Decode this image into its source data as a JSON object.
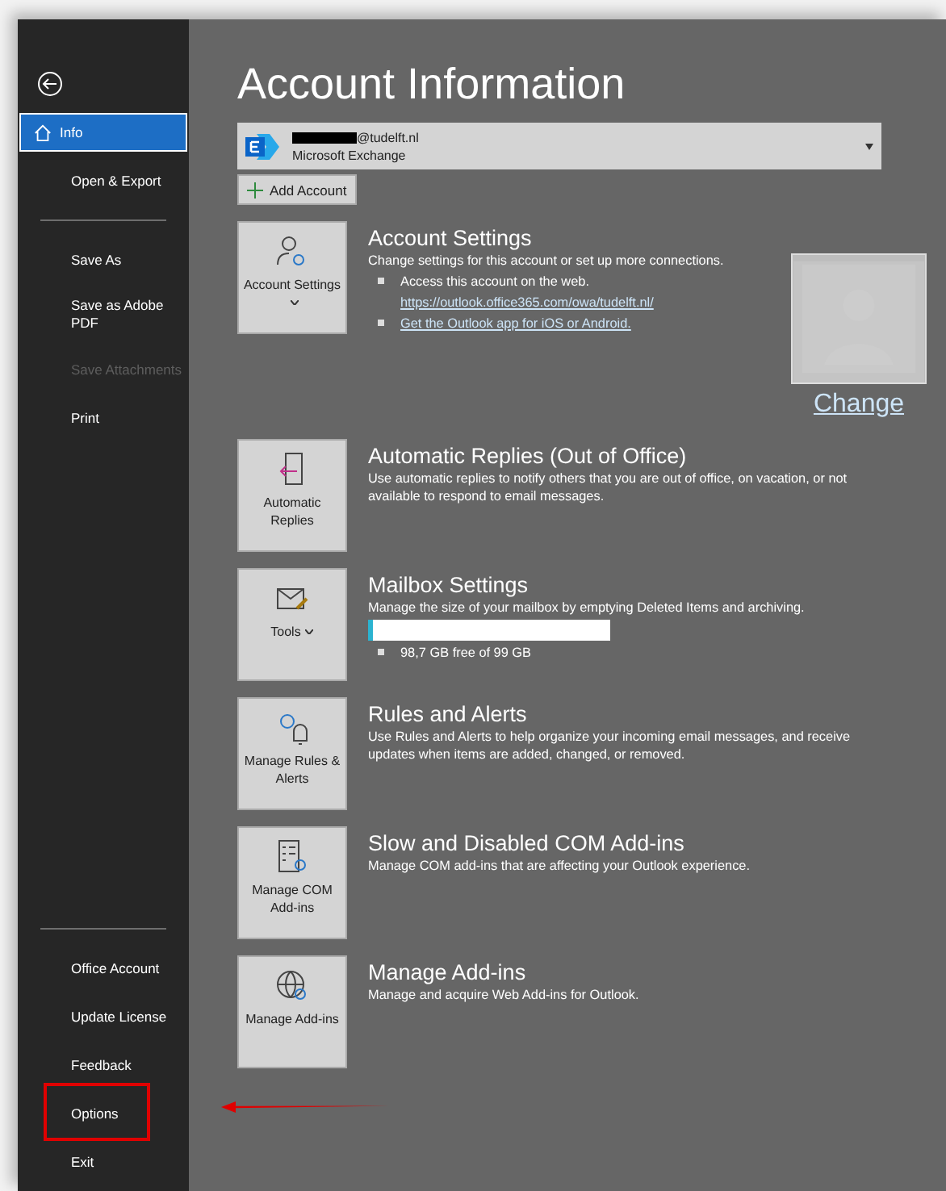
{
  "sidebar": {
    "top_items": [
      {
        "label": "Info",
        "selected": true,
        "disabled": false
      },
      {
        "label": "Open & Export",
        "selected": false,
        "disabled": false
      },
      {
        "kind": "divider"
      },
      {
        "label": "Save As",
        "selected": false,
        "disabled": false
      },
      {
        "label": "Save as Adobe PDF",
        "selected": false,
        "disabled": false
      },
      {
        "label": "Save Attachments",
        "selected": false,
        "disabled": true
      },
      {
        "label": "Print",
        "selected": false,
        "disabled": false
      }
    ],
    "bottom_items": [
      {
        "label": "Office Account",
        "selected": false,
        "disabled": false,
        "highlighted": false
      },
      {
        "label": "Update License",
        "selected": false,
        "disabled": false,
        "highlighted": false
      },
      {
        "label": "Feedback",
        "selected": false,
        "disabled": false,
        "highlighted": false
      },
      {
        "label": "Options",
        "selected": false,
        "disabled": false,
        "highlighted": true
      },
      {
        "label": "Exit",
        "selected": false,
        "disabled": false,
        "highlighted": false
      }
    ]
  },
  "title": "Account Information",
  "account": {
    "email": "@tudelft.nl",
    "type": "Microsoft Exchange"
  },
  "add_account": "Add Account",
  "sections": [
    {
      "button": "Account Settings",
      "dropdown": true,
      "title": "Account Settings",
      "description": "Change settings for this account or set up more connections.",
      "bullets": [
        {
          "text": "Access this account on the web.",
          "link": "https://outlook.office365.com/owa/tudelft.nl/"
        },
        {
          "link": "Get the Outlook app for iOS or Android."
        }
      ],
      "picture": {
        "link": "Change"
      }
    },
    {
      "button": "Automatic Replies",
      "dropdown": false,
      "title": "Automatic Replies (Out of Office)",
      "description": "Use automatic replies to notify others that you are out of office, on vacation, or not available to respond to email messages."
    },
    {
      "button": "Tools",
      "dropdown": true,
      "title": "Mailbox Settings",
      "description": "Manage the size of your mailbox by emptying Deleted Items and archiving.",
      "storage": {
        "level": 0.02,
        "text": "98,7 GB free of 99 GB"
      }
    },
    {
      "button": "Manage Rules & Alerts",
      "dropdown": false,
      "title": "Rules and Alerts",
      "description": "Use Rules and Alerts to help organize your incoming email messages, and receive updates when items are added, changed, or removed."
    },
    {
      "button": "Manage COM Add-ins",
      "dropdown": false,
      "title": "Slow and Disabled COM Add-ins",
      "description": "Manage COM add-ins that are affecting your Outlook experience."
    },
    {
      "button": "Manage Add-ins",
      "dropdown": false,
      "title": "Manage Add-ins",
      "description": "Manage and acquire Web Add-ins for Outlook."
    }
  ]
}
